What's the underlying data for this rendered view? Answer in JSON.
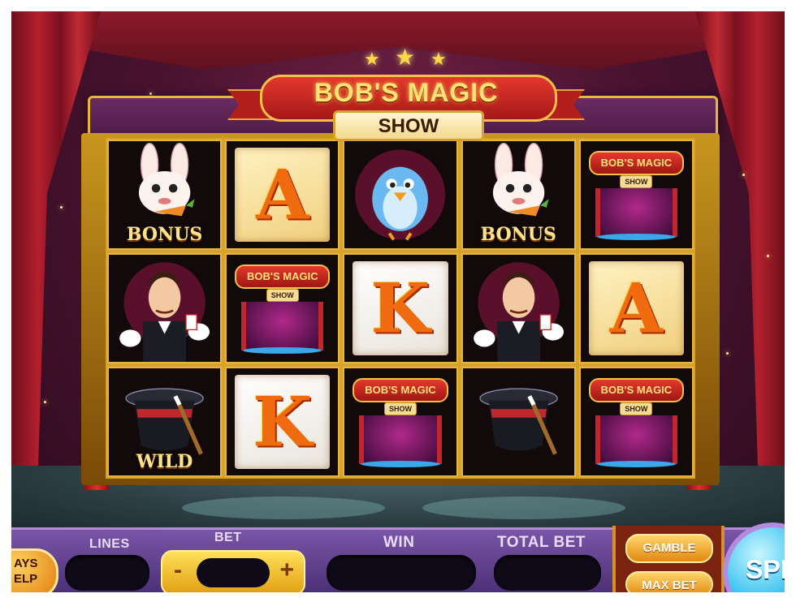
{
  "header": {
    "title": "BOB'S MAGIC",
    "subtitle": "SHOW"
  },
  "reels": [
    [
      {
        "symbol": "bunny-bonus",
        "label": "BONUS"
      },
      {
        "symbol": "letter-a",
        "label": "A"
      },
      {
        "symbol": "blue-bird",
        "label": ""
      },
      {
        "symbol": "bunny-bonus",
        "label": "BONUS"
      },
      {
        "symbol": "show-logo",
        "label": "BOB'S MAGIC",
        "sub": "SHOW"
      }
    ],
    [
      {
        "symbol": "magician",
        "label": ""
      },
      {
        "symbol": "show-logo",
        "label": "BOB'S MAGIC",
        "sub": "SHOW"
      },
      {
        "symbol": "letter-k",
        "label": "K"
      },
      {
        "symbol": "magician",
        "label": ""
      },
      {
        "symbol": "letter-a",
        "label": "A"
      }
    ],
    [
      {
        "symbol": "top-hat-wild",
        "label": "WILD"
      },
      {
        "symbol": "letter-k",
        "label": "K"
      },
      {
        "symbol": "show-logo",
        "label": "BOB'S MAGIC",
        "sub": "SHOW"
      },
      {
        "symbol": "top-hat",
        "label": ""
      },
      {
        "symbol": "show-logo",
        "label": "BOB'S MAGIC",
        "sub": "SHOW"
      }
    ]
  ],
  "controls": {
    "paytable_label": "AYS ELP",
    "lines_label": "LINES",
    "bet_label": "BET",
    "bet_minus": "-",
    "bet_plus": "+",
    "win_label": "WIN",
    "total_bet_label": "TOTAL BET",
    "gamble_label": "GAMBLE",
    "max_bet_label": "MAX BET",
    "spin_label": "SPIN"
  },
  "colors": {
    "accent_gold": "#e8b43a",
    "panel_purple": "#6a4598",
    "spin_blue": "#36c0f0",
    "ribbon_red": "#c02a24"
  }
}
